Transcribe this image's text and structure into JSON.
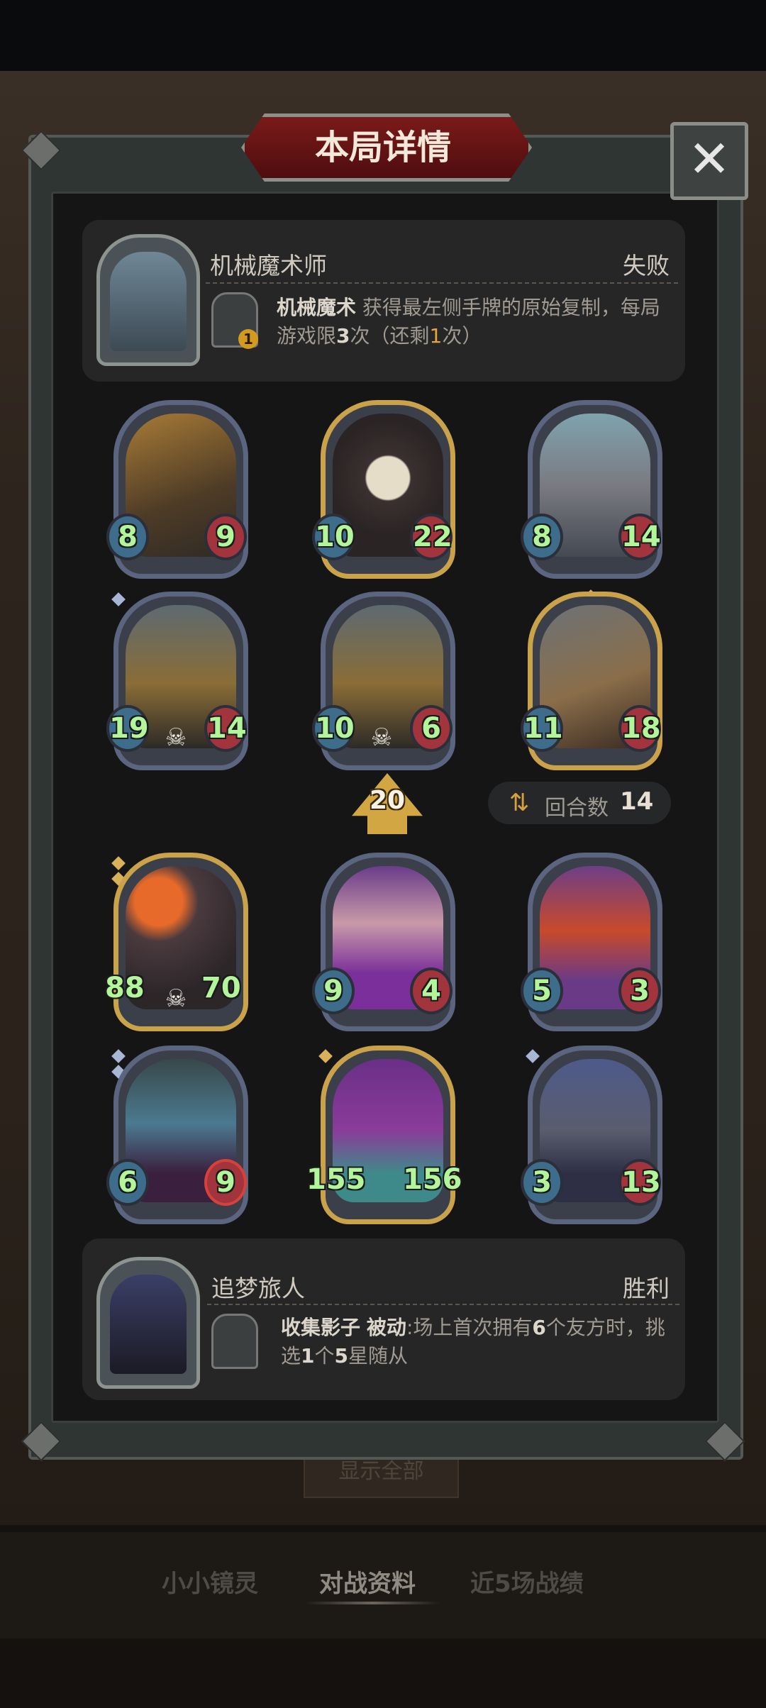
{
  "dialog": {
    "title": "本局详情",
    "close_icon": "close-icon"
  },
  "opponent": {
    "name": "机械魔术师",
    "result": "失败",
    "skill_name": "机械魔术",
    "skill_desc_a": " 获得最左侧手牌的原始复制，每局游戏限",
    "skill_count": "3",
    "skill_desc_b": "次（还剩",
    "skill_remaining": "1",
    "skill_desc_c": "次）",
    "skill_badge": "1"
  },
  "board_top": [
    {
      "atk": "8",
      "hp": "9",
      "frame": "silver",
      "art": "dragon"
    },
    {
      "atk": "10",
      "hp": "22",
      "frame": "gold",
      "art": "clock-clown"
    },
    {
      "atk": "8",
      "hp": "14",
      "frame": "silver",
      "art": "robot-cowboy"
    },
    {
      "atk": "19",
      "hp": "14",
      "frame": "silver",
      "art": "mech-bike",
      "deathrattle": true,
      "gems": 1
    },
    {
      "atk": "10",
      "hp": "6",
      "frame": "silver",
      "art": "mech-bike",
      "deathrattle": true
    },
    {
      "atk": "11",
      "hp": "18",
      "frame": "gold",
      "art": "airship",
      "gems": 1
    }
  ],
  "tavern_tier": "20",
  "round": {
    "label": "回合数",
    "value": "14",
    "icon": "swap-icon"
  },
  "board_bottom": [
    {
      "atk": "88",
      "hp": "70",
      "frame": "gold",
      "art": "fire-beast",
      "deathrattle": true,
      "gems": 2
    },
    {
      "atk": "9",
      "hp": "4",
      "frame": "silver",
      "art": "doll-girl"
    },
    {
      "atk": "5",
      "hp": "3",
      "frame": "silver",
      "art": "elf-girl"
    },
    {
      "atk": "6",
      "hp": "9",
      "frame": "silver",
      "art": "vampire",
      "gems": 2,
      "hp_effect": "target"
    },
    {
      "atk": "155",
      "hp": "156",
      "frame": "gold",
      "art": "serpent-king",
      "gems": 1
    },
    {
      "atk": "3",
      "hp": "13",
      "frame": "silver",
      "art": "rat-bandit",
      "gems": 1
    }
  ],
  "player": {
    "name": "追梦旅人",
    "result": "胜利",
    "skill_name": "收集影子",
    "skill_type": "被动",
    "skill_desc_a": ":场上首次拥有",
    "skill_count_1": "6",
    "skill_desc_b": "个友方时，挑选",
    "skill_count_2": "1",
    "skill_desc_c": "个",
    "skill_count_3": "5",
    "skill_desc_d": "星随从"
  },
  "show_all_button": "显示全部",
  "bottom_nav": [
    "小小镜灵",
    "对战资料",
    "近5场战绩"
  ],
  "colors": {
    "gold_frame": "#c9a24a",
    "silver_frame": "#5b6580",
    "stat_green": "#b3f59a",
    "highlight": "#e8a33c"
  }
}
